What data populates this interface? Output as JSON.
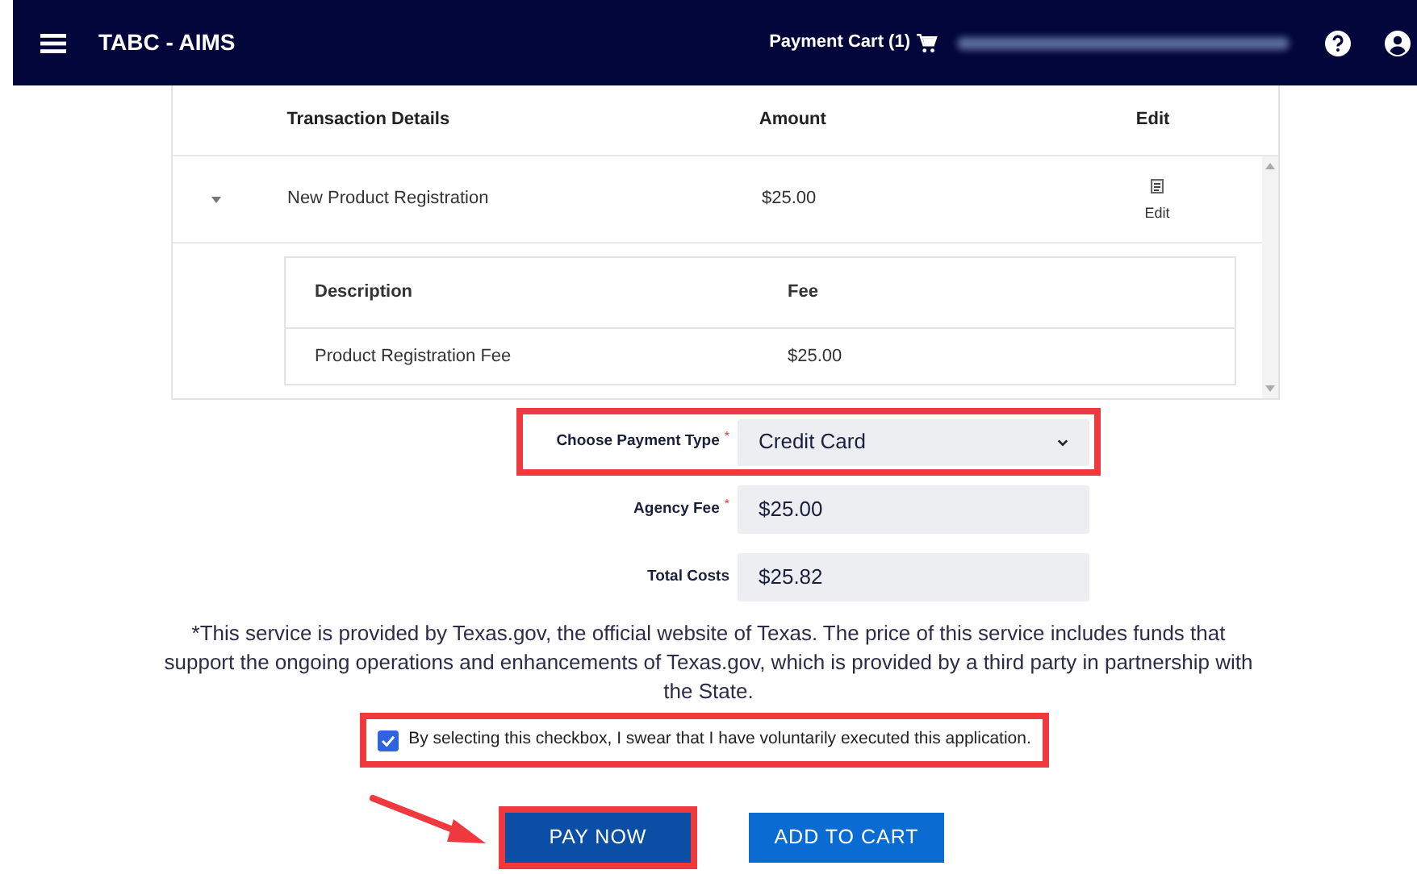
{
  "header": {
    "title": "TABC - AIMS",
    "cart_label": "Payment Cart (1)"
  },
  "transactions": {
    "columns": [
      "Transaction Details",
      "Amount",
      "Edit"
    ],
    "rows": [
      {
        "details": "New Product Registration",
        "amount": "$25.00",
        "edit_label": "Edit",
        "expanded": true,
        "fees": {
          "columns": [
            "Description",
            "Fee"
          ],
          "rows": [
            {
              "description": "Product Registration Fee",
              "fee": "$25.00"
            }
          ]
        }
      }
    ]
  },
  "form": [
    {
      "kind": "select",
      "label": "Choose Payment Type",
      "required_mark": "*",
      "value": "Credit Card",
      "highlighted": true
    },
    {
      "kind": "readonly",
      "label": "Agency Fee",
      "required_mark": "*",
      "value": "$25.00",
      "highlighted": false
    },
    {
      "kind": "readonly",
      "label": "Total Costs",
      "value": "$25.82",
      "highlighted": false
    }
  ],
  "disclaimer": "*This service is provided by Texas.gov, the official website of Texas. The price of this service includes funds that support the ongoing operations and enhancements of Texas.gov, which is provided by a third party in partnership with the State.",
  "attestation": {
    "label": "By selecting this checkbox, I swear that I have voluntarily executed this application.",
    "checked": true,
    "highlighted": true
  },
  "buttons": [
    {
      "label": "PAY NOW",
      "kind": "primary",
      "highlighted": true
    },
    {
      "label": "ADD TO CART",
      "kind": "secondary",
      "highlighted": false
    }
  ]
}
